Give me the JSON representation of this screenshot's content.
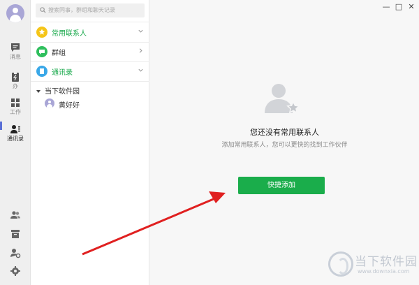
{
  "rail": {
    "items": [
      {
        "label": "消息",
        "icon": "chat-icon"
      },
      {
        "label": "办",
        "icon": "todo-icon"
      },
      {
        "label": "工作",
        "icon": "grid-icon"
      },
      {
        "label": "通讯录",
        "icon": "contacts-icon"
      }
    ],
    "bottom_icons": [
      "group-people-icon",
      "archive-icon",
      "user-settings-icon",
      "gear-icon"
    ]
  },
  "search": {
    "placeholder": "搜索同事，群组和聊天记录"
  },
  "groups": [
    {
      "label": "常用联系人",
      "icon": "star-icon",
      "color": "#f5c518"
    },
    {
      "label": "群组",
      "icon": "group-chat-icon",
      "color": "#2fbf5d"
    },
    {
      "label": "通讯录",
      "icon": "address-book-icon",
      "color": "#3aa8e8"
    }
  ],
  "org": {
    "name": "当下软件园",
    "members": [
      "黄好好"
    ]
  },
  "empty": {
    "title": "您还没有常用联系人",
    "subtitle": "添加常用联系人，您可以更快的找到工作伙伴",
    "button": "快捷添加"
  },
  "window": {
    "minimize": "—",
    "maximize": "□",
    "close": "✕"
  },
  "watermark": {
    "name": "当下软件园",
    "url": "www.downxia.com"
  },
  "colors": {
    "accent_green": "#1aad4b",
    "annotation_arrow": "#e02020"
  }
}
